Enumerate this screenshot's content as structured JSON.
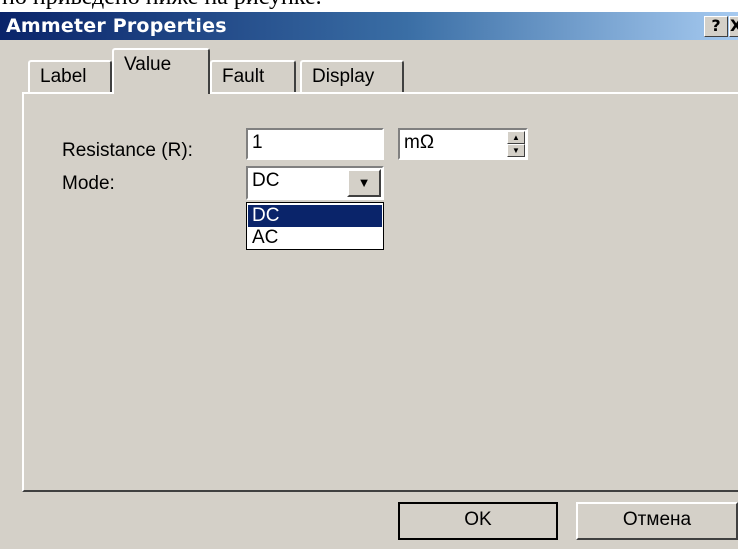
{
  "document": {
    "caption_fragment": "но приведено ниже на рисунке."
  },
  "window": {
    "title": "Ammeter Properties",
    "help_glyph": "?",
    "close_glyph": "X"
  },
  "tabs": [
    {
      "label": "Label",
      "selected": false
    },
    {
      "label": "Value",
      "selected": true
    },
    {
      "label": "Fault",
      "selected": false
    },
    {
      "label": "Display",
      "selected": false
    }
  ],
  "form": {
    "resistance_label": "Resistance (R):",
    "resistance_value": "1",
    "resistance_unit": "mΩ",
    "mode_label": "Mode:",
    "mode_value": "DC",
    "mode_options": [
      "DC",
      "AC"
    ],
    "mode_highlighted": "DC"
  },
  "buttons": {
    "ok": "OK",
    "cancel": "Отмена"
  },
  "colors": {
    "titlebar_start": "#0a246a",
    "titlebar_end": "#a6caf0",
    "dialog_face": "#d4d0c8",
    "selection": "#0a246a"
  }
}
